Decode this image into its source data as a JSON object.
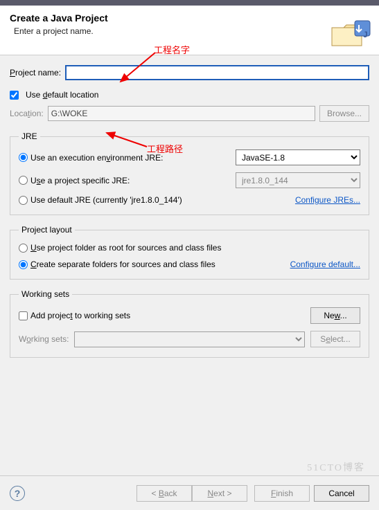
{
  "header": {
    "title": "Create a Java Project",
    "subtitle": "Enter a project name."
  },
  "annotations": {
    "name_hint": "工程名字",
    "path_hint": "工程路径"
  },
  "project_name": {
    "label": "Project name:",
    "value": ""
  },
  "location": {
    "checkbox_label": "Use default location",
    "label": "Location:",
    "value": "G:\\WOKE",
    "browse": "Browse..."
  },
  "jre": {
    "legend": "JRE",
    "exec_env_label": "Use an execution environment JRE:",
    "exec_env_value": "JavaSE-1.8",
    "project_specific_label": "Use a project specific JRE:",
    "project_specific_value": "jre1.8.0_144",
    "default_label": "Use default JRE (currently 'jre1.8.0_144')",
    "configure_link": "Configure JREs..."
  },
  "layout": {
    "legend": "Project layout",
    "opt1": "Use project folder as root for sources and class files",
    "opt2": "Create separate folders for sources and class files",
    "configure_link": "Configure default..."
  },
  "working_sets": {
    "legend": "Working sets",
    "add_label": "Add project to working sets",
    "new_btn": "New...",
    "sets_label": "Working sets:",
    "select_btn": "Select..."
  },
  "footer": {
    "back": "< Back",
    "next": "Next >",
    "finish": "Finish",
    "cancel": "Cancel"
  },
  "watermark": "51CTO博客"
}
